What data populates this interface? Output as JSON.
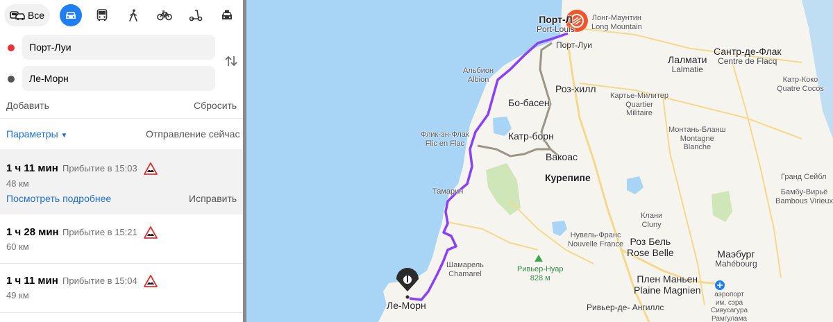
{
  "modes": {
    "all_label": "Все",
    "items": [
      {
        "id": "car",
        "icon": "car-icon",
        "active": true
      },
      {
        "id": "bus",
        "icon": "bus-icon"
      },
      {
        "id": "walk",
        "icon": "walk-icon"
      },
      {
        "id": "bike",
        "icon": "bicycle-icon"
      },
      {
        "id": "scooter",
        "icon": "scooter-icon"
      },
      {
        "id": "taxi",
        "icon": "taxi-icon"
      }
    ]
  },
  "from_field": {
    "value": "Порт-Луи",
    "dot_color": "#e8333a"
  },
  "to_field": {
    "value": "Ле-Морн",
    "dot_color": "#555555"
  },
  "actions": {
    "add": "Добавить",
    "reset": "Сбросить"
  },
  "params": {
    "label": "Параметры",
    "departure": "Отправление сейчас"
  },
  "routes": [
    {
      "duration": "1 ч 11 мин",
      "arrival": "Прибытие в 15:03",
      "distance": "48 км",
      "details_link": "Посмотреть подробнее",
      "fix_link": "Исправить",
      "selected": true
    },
    {
      "duration": "1 ч 28 мин",
      "arrival": "Прибытие в 15:21",
      "distance": "60 км"
    },
    {
      "duration": "1 ч 11 мин",
      "arrival": "Прибытие в 15:04",
      "distance": "49 км"
    }
  ],
  "map": {
    "colors": {
      "sea": "#a8d4f5",
      "land": "#f6f4ef",
      "route_main": "#8a3ffc",
      "route_alt": "#9b9488",
      "road": "#f5d98a",
      "park": "#cfe6b8"
    },
    "labels": {
      "port_louis_ru": "Порт-Л",
      "port_louis_en": "Port-Louis",
      "port_louis_marker": "Порт-Луи",
      "long_mountain_ru": "Лонг-Маунтин",
      "long_mountain_en": "Long Mountain",
      "albion_ru": "Альбион",
      "albion_en": "Albion",
      "lalmatie_ru": "Лалмати",
      "lalmatie_en": "Lalmatie",
      "flacq_ru": "Сантр-де-Флак",
      "flacq_en": "Centre de Flacq",
      "quatre_cocos_ru": "Катр-Коко",
      "quatre_cocos_en": "Quatre Cocos",
      "rose_hill": "Роз-хилл",
      "quartier_ru": "Картье-Милитер",
      "quartier_en1": "Quartier",
      "quartier_en2": "Militaire",
      "beau_bassin": "Бо-басен",
      "flic_ru": "Флик-эн-Флак",
      "flic_en": "Flic en Flac",
      "quatre_bornes": "Катр-борн",
      "montagne_ru": "Монтань-Бланш",
      "montagne_en1": "Montagne",
      "montagne_en2": "Blanche",
      "vacoas": "Вакоас",
      "curepipe": "Курепипе",
      "grand_sable": "Гранд Сейбл",
      "bambous_ru": "Бамбу-Вирьё",
      "bambous_en": "Bambous Virieux",
      "tamarin": "Тамарин",
      "cluny_ru": "Клани",
      "cluny_en": "Cluny",
      "nouvelle_ru": "Нувель-Франс",
      "nouvelle_en": "Nouvelle France",
      "rose_belle_ru": "Роз Бель",
      "rose_belle_en": "Rose Belle",
      "mahebourg_ru": "Маэбург",
      "mahebourg_en": "Mahébourg",
      "chamarel_ru": "Шамарель",
      "chamarel_en": "Chamarel",
      "riviere_noire": "Ривьер-Нуар",
      "riviere_noire_height": "828 м",
      "plaine_ru": "Плен Маньен",
      "plaine_en": "Plaine Magnien",
      "airport_1": "аэропорт",
      "airport_2": "им. сэра",
      "airport_3": "Сивусагура",
      "airport_4": "Рамгулама",
      "le_morne": "Ле-Морн",
      "riviere_anguilles": "Ривьер-де-",
      "riviere_anguilles_2": "Ангиллс"
    }
  }
}
